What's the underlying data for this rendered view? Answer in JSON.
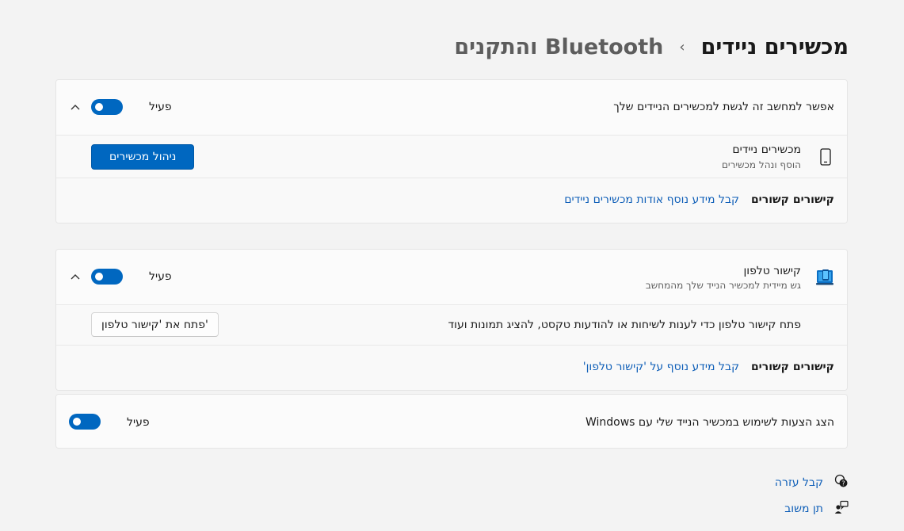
{
  "breadcrumb": {
    "parent": "Bluetooth והתקנים",
    "separator": "›",
    "current": "מכשירים ניידים"
  },
  "allow_section": {
    "label": "אפשר למחשב זה לגשת למכשירים הניידים שלך",
    "toggle_state": "פעיל",
    "toggle_on": true,
    "mobile_devices": {
      "title": "מכשירים ניידים",
      "subtitle": "הוסף ונהל מכשירים",
      "button": "ניהול מכשירים",
      "icon": "phone-icon"
    },
    "related": {
      "label": "קישורים קשורים",
      "link": "קבל מידע נוסף אודות מכשירים ניידים"
    }
  },
  "phone_link_section": {
    "title": "קישור טלפון",
    "subtitle": "גש מיידית למכשיר הנייד שלך מהמחשב",
    "toggle_state": "פעיל",
    "toggle_on": true,
    "icon": "phone-link-app-icon",
    "description": "פתח קישור טלפון כדי לענות לשיחות או להודעות טקסט, להציג תמונות ועוד",
    "button": "פתח את 'קישור טלפון'",
    "related": {
      "label": "קישורים קשורים",
      "link": "קבל מידע נוסף על 'קישור טלפון'"
    }
  },
  "suggestions_section": {
    "label": "הצג הצעות לשימוש במכשיר הנייד שלי עם Windows",
    "toggle_state": "פעיל",
    "toggle_on": true
  },
  "footer": {
    "help": "קבל עזרה",
    "feedback": "תן משוב"
  },
  "colors": {
    "accent": "#0067c0",
    "link": "#0f5fb8",
    "background": "#f3f3f3",
    "card": "#fbfbfb"
  }
}
